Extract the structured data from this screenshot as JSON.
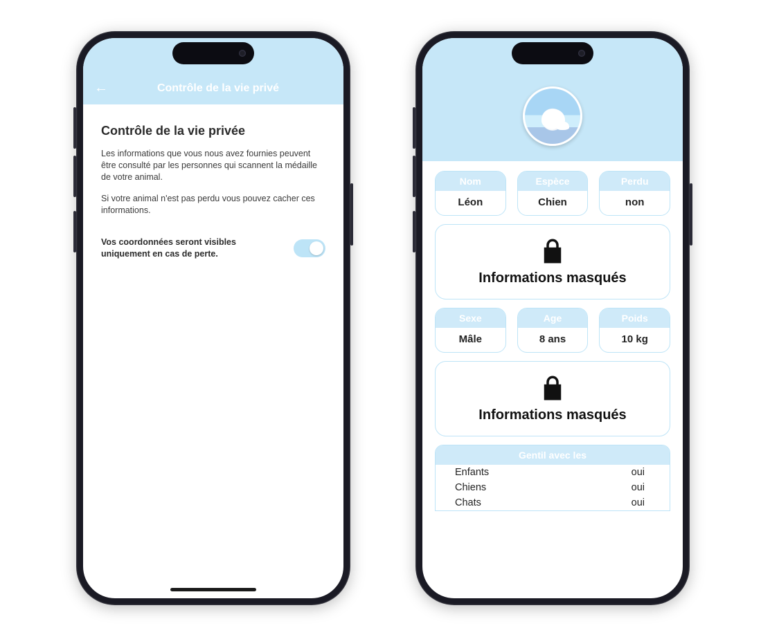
{
  "left": {
    "appbar_title": "Contrôle de la vie privé",
    "heading": "Contrôle de la vie privée",
    "para1": "Les informations que vous nous avez fournies peuvent être consulté par les personnes qui scannent la médaille de votre animal.",
    "para2": "Si votre animal n'est pas perdu vous pouvez cacher ces informations.",
    "toggle_label": "Vos coordonnées seront visibles uniquement en cas de perte.",
    "toggle_on": true
  },
  "right": {
    "pills_top": [
      {
        "label": "Nom",
        "value": "Léon"
      },
      {
        "label": "Espèce",
        "value": "Chien"
      },
      {
        "label": "Perdu",
        "value": "non"
      }
    ],
    "masked_text": "Informations masqués",
    "pills_mid": [
      {
        "label": "Sexe",
        "value": "Mâle"
      },
      {
        "label": "Age",
        "value": "8 ans"
      },
      {
        "label": "Poids",
        "value": "10 kg"
      }
    ],
    "friendly": {
      "title": "Gentil avec les",
      "rows": [
        {
          "k": "Enfants",
          "v": "oui"
        },
        {
          "k": "Chiens",
          "v": "oui"
        },
        {
          "k": "Chats",
          "v": "oui"
        }
      ]
    }
  }
}
